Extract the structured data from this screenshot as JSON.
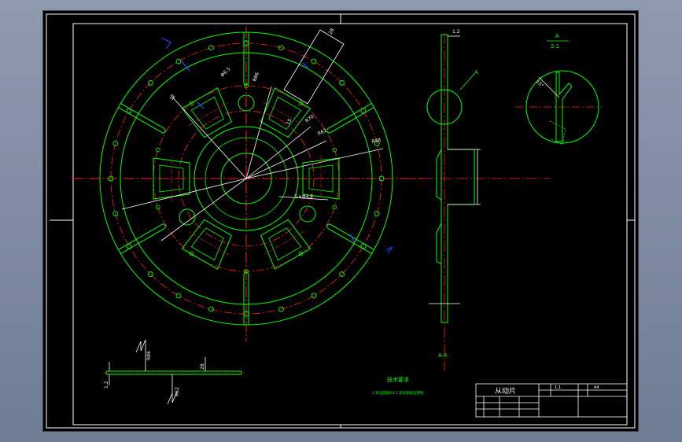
{
  "drawing": {
    "title_block": {
      "part_name": "从动片",
      "scale_value": "1:1",
      "sheet_value": "A4"
    },
    "notes": {
      "heading": "技术要求",
      "line1": "1.未注圆角R0.5 去毛刺锐边倒钝"
    },
    "detail": {
      "label": "A",
      "scale": "2:1"
    },
    "section_label": "A-A",
    "dims": {
      "d1": "R48",
      "d2": "R62",
      "d3": "R70",
      "d4": "R86",
      "d5": "5×Φ4.5",
      "d6": "Φ6.5",
      "d7": "12",
      "d8": "15",
      "d9": "28",
      "d10": "15°",
      "d11": "1.2"
    },
    "colors": {
      "outline": "#00ff00",
      "center": "#ff2020",
      "dimension": "#ffffff",
      "accent": "#2040ff",
      "text": "#00ff00"
    }
  }
}
